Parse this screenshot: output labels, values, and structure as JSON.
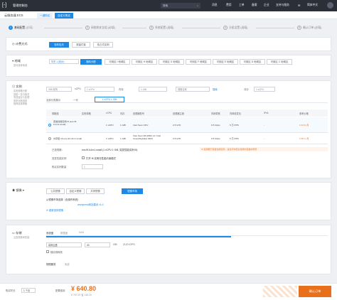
{
  "topbar": {
    "brand": "管理控制台",
    "search_placeholder": "搜索",
    "nav": [
      "消息",
      "费用",
      "工单",
      "备案",
      "企业",
      "支持与服务",
      "简体",
      "中文"
    ],
    "menu_icon": "menu-icon",
    "avatar": "用户头像"
  },
  "subbar": {
    "title": "云服务器 ECS",
    "tab_quick": "一键购买",
    "tab_custom": "自定义购买"
  },
  "steps": [
    {
      "num": "1",
      "label": "基础配置",
      "hint": "(必填)"
    },
    {
      "num": "2",
      "label": "网络和安全组",
      "hint": "(必填)"
    },
    {
      "num": "3",
      "label": "系统配置",
      "hint": "(选填)"
    },
    {
      "num": "4",
      "label": "分组设置",
      "hint": "(选填)"
    },
    {
      "num": "5",
      "label": "确认订单",
      "hint": "(必填)"
    }
  ],
  "billing": {
    "label": "计费方式",
    "options": [
      "包年包月",
      "按量付费",
      "抢占式实例"
    ]
  },
  "region": {
    "label": "地域",
    "note": "如何选择地域",
    "region_select": "华东 1 (杭州)",
    "zones": [
      "随机分配",
      "可用区 I 地域区",
      "可用区 H 地域区",
      "可用区 G 地域区",
      "可用区 F 地域区",
      "可用区 E 地域区",
      "可用区 D 地域区",
      "可用区 C 地域区"
    ]
  },
  "instance": {
    "label": "实例",
    "notes": [
      "实例规格分配",
      "选型一览与相关",
      "完成建议与处理",
      "需求对照选择",
      "推荐选择规格"
    ],
    "filters": {
      "arch": "X86 架构",
      "vcpu_label": "vCPU",
      "vcpu_value": "1 vCPU",
      "mem_label": "内存",
      "mem_value": "1 GiB",
      "name_placeholder": "规格名称",
      "search_label": "搜索",
      "sort_label": "评分",
      "sort_value": "1 vCPU"
    },
    "tabs": [
      "全部分类展示",
      "一代",
      "1 vCPU 1 GiB"
    ],
    "headers": [
      "规格族",
      "实例规格",
      "vCPU",
      "内存",
      "处理器型号",
      "处理器主频",
      "内网带宽",
      "内网收发包",
      "IPv6",
      "参考价格"
    ],
    "rows": [
      {
        "family": "突发性能实例 t5 (ecs.t5-lc1m1.small)",
        "spec": "ecs.t5-lc1m1.small",
        "vcpu": "1 vCPU",
        "mem": "1 GiB",
        "cpu": "Intel Xeon CPU",
        "freq": "2.5 GHz",
        "bw": "0.5 Gbps",
        "pps": "5 万 PPS",
        "ipv6": "-",
        "price": "¥ 43.8 /月"
      },
      {
        "family": "共享型 s6 ecs.s6-c1m1.small",
        "spec": "ecs.s6-c1m1.small",
        "vcpu": "1 vCPU",
        "mem": "1 GiB",
        "cpu": "Intel Xeon E5-2682 v4 / Intel Xeon(Skylake) 8163",
        "freq": "2.5 GHz",
        "bw": "0.5 Gbps",
        "pps": "5 万 PPS",
        "ipv6": "-",
        "price": "¥ 56.4 /月"
      }
    ],
    "selected_label": "已选规格：",
    "selected_value": "ecs.t5-lc1m1.small (1 vCPU 1 GiB, 突发性能实例 t5)",
    "selected_warn": "t5 实例属于突发性能实例，适合平时低负载偶尔突发的场景",
    "perf_label": "突发性能实例",
    "perf_check": "打开 t5 实例无性能约束模式",
    "count_label": "购买实例数量",
    "count_value": "1"
  },
  "image": {
    "label": "镜像",
    "tabs": [
      "公共镜像",
      "自定义镜像",
      "共享镜像",
      "镜像市场"
    ],
    "choose_text": "从镜像市场选择（含操作系统）",
    "current": "wordpress网站建设 v1.0",
    "reselect": "重新选择镜像"
  },
  "storage": {
    "label": "存储",
    "note1": "云盘参数和性能",
    "tabs": [
      "系统盘",
      "数据盘",
      "NAS"
    ],
    "disk_type": "高效云盘",
    "size": "40",
    "unit": "GiB",
    "iops": "2120 IOPS",
    "release": "随实例释放",
    "snapshot_label": "快照服务",
    "snapshot_note": "免费"
  },
  "footer": {
    "duration_label": "购买时长",
    "duration_value": "1 个月",
    "fee_label": "配置费用",
    "price": "¥ 640.80",
    "sub": "¥ 787.00 省 146.20",
    "confirm": "确认订单"
  },
  "colors": {
    "accent": "#1e88e5",
    "orange": "#e8701a",
    "topbar": "#2a2f38"
  }
}
